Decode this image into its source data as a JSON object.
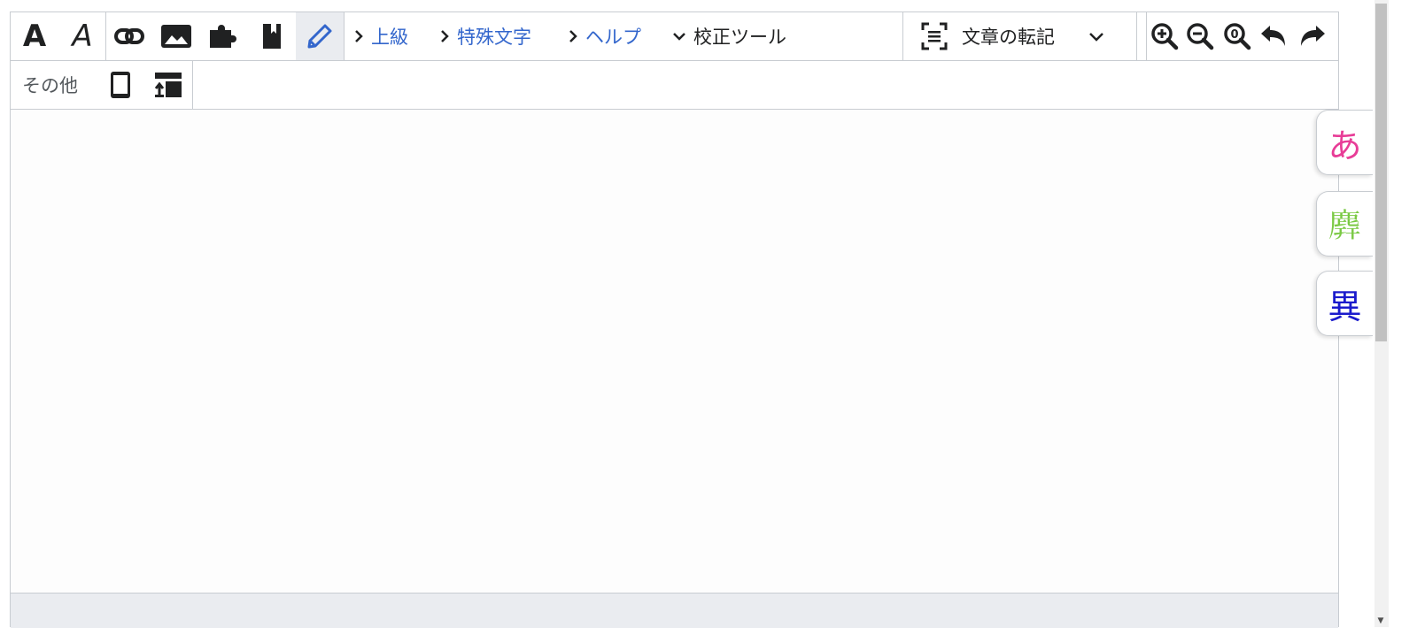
{
  "toolbar": {
    "bold_glyph": "A",
    "italic_glyph": "A",
    "menus": {
      "advanced": "上級",
      "special_chars": "特殊文字",
      "help": "ヘルプ",
      "proofread": "校正ツール"
    },
    "transcribe_label": "文章の転記",
    "icons": [
      "bold-icon",
      "italic-icon",
      "link-icon",
      "image-icon",
      "puzzle-icon",
      "bookmark-icon",
      "pencil-icon",
      "chevron-right-icon",
      "chevron-down-icon",
      "transcribe-icon",
      "zoom-in-icon",
      "zoom-out-icon",
      "zoom-reset-icon",
      "undo-icon",
      "redo-icon"
    ],
    "zoom_reset_digit": "0"
  },
  "toolbar2": {
    "other_label": "その他",
    "icons": [
      "tablet-icon",
      "layout-toggle-icon"
    ]
  },
  "side_tabs": [
    {
      "label": "あ",
      "color": "#e83d97"
    },
    {
      "label": "𪊑",
      "color": "#7ac943"
    },
    {
      "label": "異",
      "color": "#1a1acc"
    }
  ],
  "colors": {
    "accent": "#3366cc",
    "active_bg": "#eaecf0",
    "border": "#c8ccd1"
  }
}
